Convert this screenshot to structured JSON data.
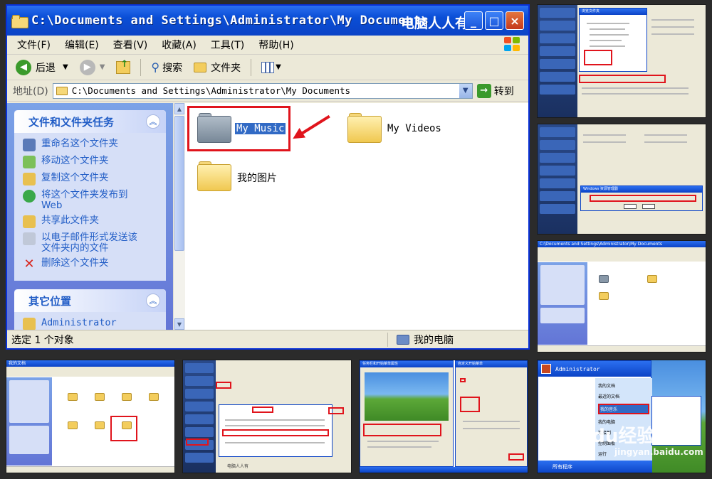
{
  "window": {
    "title": "C:\\Documents and Settings\\Administrator\\My Documents",
    "brand": "电脑人人有"
  },
  "menu": [
    "文件(F)",
    "编辑(E)",
    "查看(V)",
    "收藏(A)",
    "工具(T)",
    "帮助(H)"
  ],
  "toolbar": {
    "back": "后退",
    "search": "搜索",
    "folders": "文件夹"
  },
  "address": {
    "label": "地址(D)",
    "value": "C:\\Documents and Settings\\Administrator\\My Documents",
    "go": "转到"
  },
  "tasks": {
    "title": "文件和文件夹任务",
    "items": [
      "重命名这个文件夹",
      "移动这个文件夹",
      "复制这个文件夹",
      "将这个文件夹发布到Web",
      "共享此文件夹",
      "以电子邮件形式发送该文件夹内的文件",
      "删除这个文件夹"
    ]
  },
  "other_places": {
    "title": "其它位置",
    "items": [
      "Administrator"
    ]
  },
  "files": [
    {
      "name": "My Music",
      "selected": true,
      "color": "gray"
    },
    {
      "name": "My Videos",
      "selected": false,
      "color": "yellow"
    },
    {
      "name": "我的图片",
      "selected": false,
      "color": "yellow"
    }
  ],
  "status": {
    "left": "选定 1 个对象",
    "right": "我的电脑"
  },
  "thumbs": {
    "t5_user": "Administrator",
    "t5_items": [
      "我的文档",
      "最近的文档",
      "我的音乐",
      "我的电脑",
      "连接到",
      "控制面板",
      "运行"
    ],
    "t5_all_programs": "所有程序",
    "watermark": "Baidu经验",
    "watermark_url": "jingyan.baidu.com"
  },
  "colors": {
    "title_blue": "#0b43c6",
    "accent_red": "#e0141c",
    "task_link": "#215dc6"
  }
}
